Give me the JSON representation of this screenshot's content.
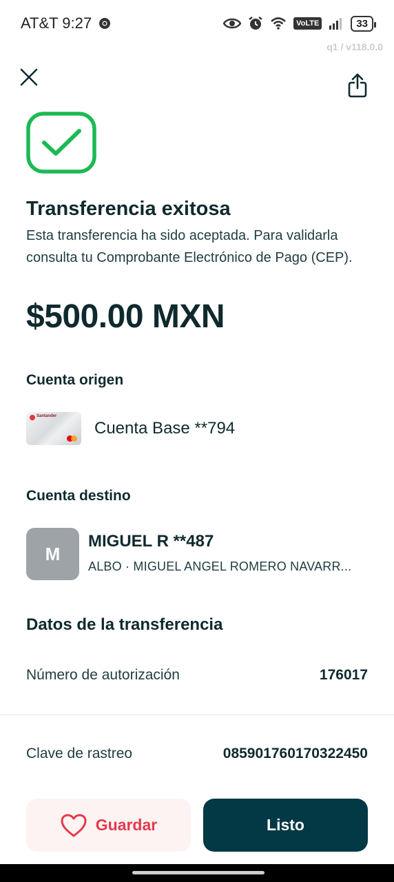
{
  "status_bar": {
    "carrier_time": "AT&T 9:27",
    "volte": "VoLTE",
    "battery": "33"
  },
  "version": "q1 / v118.0.0",
  "header": {
    "close_icon": "close-icon",
    "share_icon": "share-icon"
  },
  "result": {
    "icon": "check-icon",
    "accent_color": "#1db954",
    "title": "Transferencia exitosa",
    "subtitle": "Esta transferencia ha sido aceptada. Para validarla consulta tu Comprobante Electrónico de Pago (CEP).",
    "amount": "$500.00 MXN"
  },
  "origin": {
    "label": "Cuenta origen",
    "account_name": "Cuenta Base **794",
    "card_bank_text": "Santander"
  },
  "destination": {
    "label": "Cuenta destino",
    "avatar_initial": "M",
    "name": "MIGUEL R **487",
    "detail": "ALBO · MIGUEL ANGEL ROMERO NAVARR..."
  },
  "transfer_data": {
    "label": "Datos de la transferencia",
    "rows": [
      {
        "label": "Número de autorización",
        "value": "176017"
      },
      {
        "label": "Clave de rastreo",
        "value": "085901760170322450"
      }
    ]
  },
  "actions": {
    "save_label": "Guardar",
    "done_label": "Listo",
    "save_color": "#e23a4e",
    "done_color": "#033845"
  }
}
